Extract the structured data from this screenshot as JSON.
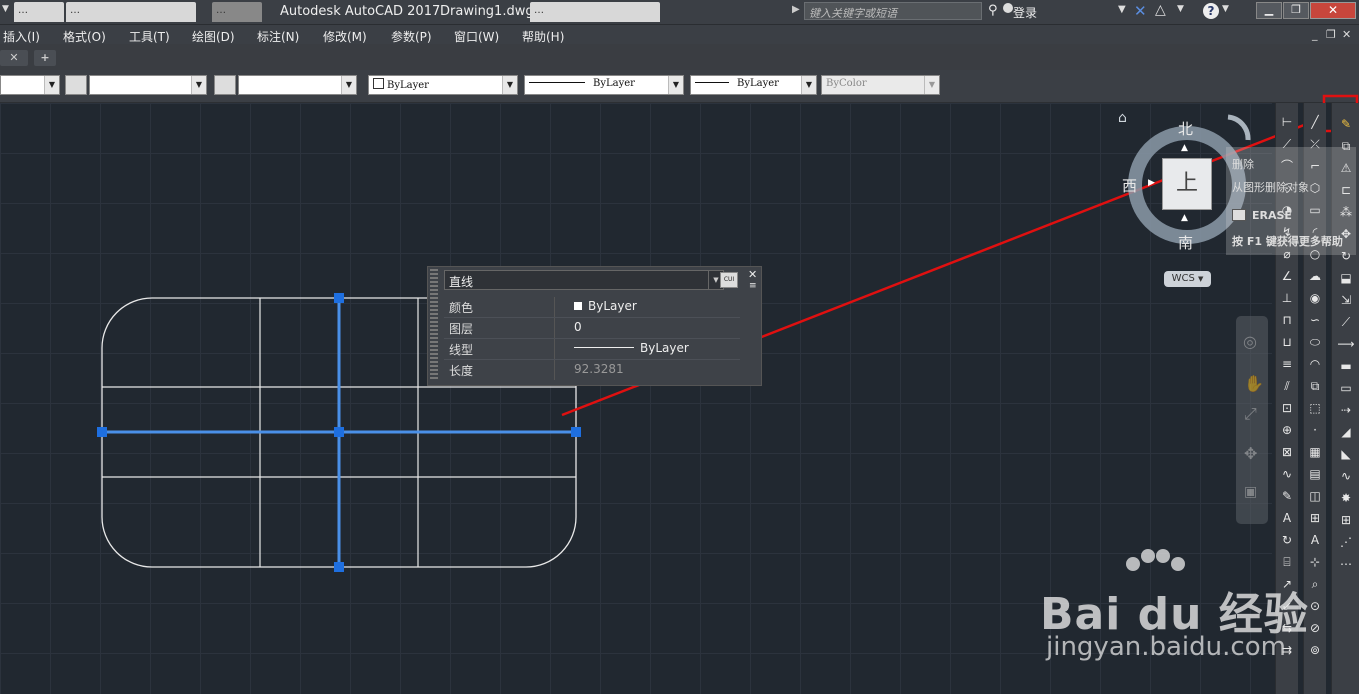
{
  "titlebar": {
    "tabs": [
      "…",
      "…",
      "…",
      "…"
    ],
    "app_title": "Autodesk AutoCAD 2017",
    "doc_title": "Drawing1.dwg",
    "search_placeholder": "键入关键字或短语",
    "login_label": "登录"
  },
  "menubar": {
    "items": [
      "插入(I)",
      "格式(O)",
      "工具(T)",
      "绘图(D)",
      "标注(N)",
      "修改(M)",
      "参数(P)",
      "窗口(W)",
      "帮助(H)"
    ]
  },
  "properties_toolbar": {
    "color": "ByLayer",
    "linetype": "ByLayer",
    "lineweight": "ByLayer",
    "plotstyle": "ByColor"
  },
  "viewcube": {
    "north": "北",
    "south": "南",
    "west": "西",
    "face": "上",
    "wcs_label": "WCS"
  },
  "quick_properties": {
    "object_type": "直线",
    "rows": [
      {
        "label": "颜色",
        "value": "ByLayer"
      },
      {
        "label": "图层",
        "value": "0"
      },
      {
        "label": "线型",
        "value": "ByLayer"
      },
      {
        "label": "长度",
        "value": "92.3281"
      }
    ]
  },
  "tooltip": {
    "title": "删除",
    "description": "从图形删除对象",
    "command": "ERASE",
    "help": "按 F1 键获得更多帮助"
  },
  "watermark": {
    "brand": "Bai du 经验",
    "url": "jingyan.baidu.com"
  },
  "colors": {
    "canvas_bg": "#212830",
    "selection": "#4a90e8",
    "grip": "#1e6fe0",
    "arrow": "#e01010"
  }
}
